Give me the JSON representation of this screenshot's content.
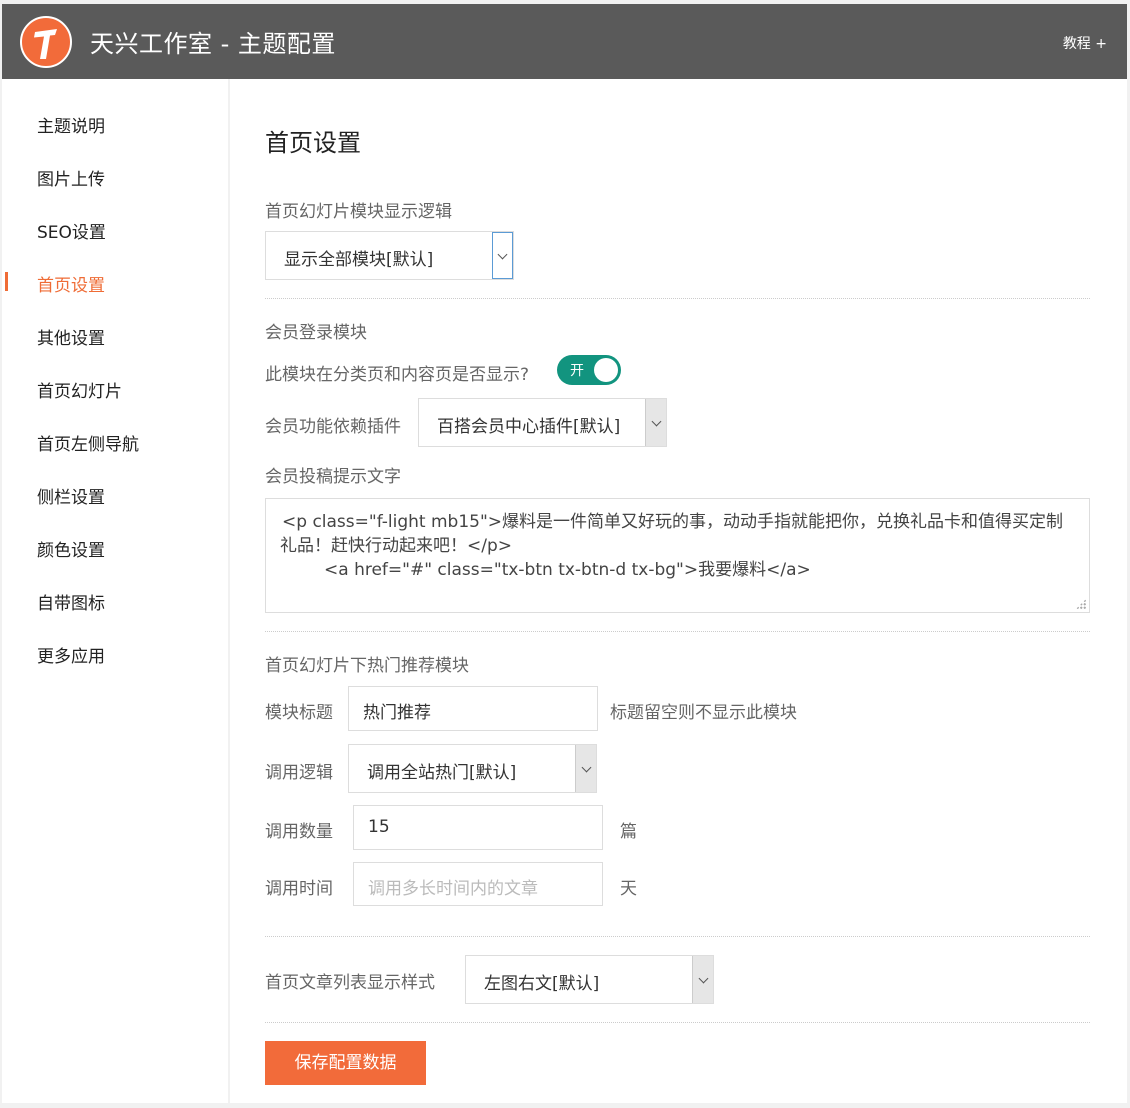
{
  "header": {
    "title": "天兴工作室 - 主题配置",
    "tutorial": "教程 +",
    "accent": "#f26b3a"
  },
  "sidebar": {
    "items": [
      {
        "label": "主题说明"
      },
      {
        "label": "图片上传"
      },
      {
        "label": "SEO设置"
      },
      {
        "label": "首页设置"
      },
      {
        "label": "其他设置"
      },
      {
        "label": "首页幻灯片"
      },
      {
        "label": "首页左侧导航"
      },
      {
        "label": "侧栏设置"
      },
      {
        "label": "颜色设置"
      },
      {
        "label": "自带图标"
      },
      {
        "label": "更多应用"
      }
    ],
    "active": "首页设置"
  },
  "main": {
    "title": "首页设置",
    "slider_logic": {
      "label": "首页幻灯片模块显示逻辑",
      "value": "显示全部模块[默认]"
    },
    "member": {
      "section": "会员登录模块",
      "show_label": "此模块在分类页和内容页是否显示?",
      "toggle_text": "开",
      "toggle_on": true,
      "plugin_label": "会员功能依赖插件",
      "plugin_value": "百搭会员中心插件[默认]",
      "tip_label": "会员投稿提示文字",
      "tip_lines": [
        "<p class=\"f-light mb15\">爆料是一件简单又好玩的事，动动手指就能把你，兑换礼品卡和值得买定制",
        "礼品！赶快行动起来吧！</p>",
        "<a href=\"#\" class=\"tx-btn tx-btn-d tx-bg\">我要爆料</a>"
      ]
    },
    "hot": {
      "section": "首页幻灯片下热门推荐模块",
      "title_label": "模块标题",
      "title_value": "热门推荐",
      "title_hint": "标题留空则不显示此模块",
      "logic_label": "调用逻辑",
      "logic_value": "调用全站热门[默认]",
      "count_label": "调用数量",
      "count_value": "15",
      "count_unit": "篇",
      "time_label": "调用时间",
      "time_placeholder": "调用多长时间内的文章",
      "time_unit": "天"
    },
    "list_style": {
      "label": "首页文章列表显示样式",
      "value": "左图右文[默认]"
    },
    "save_label": "保存配置数据"
  }
}
